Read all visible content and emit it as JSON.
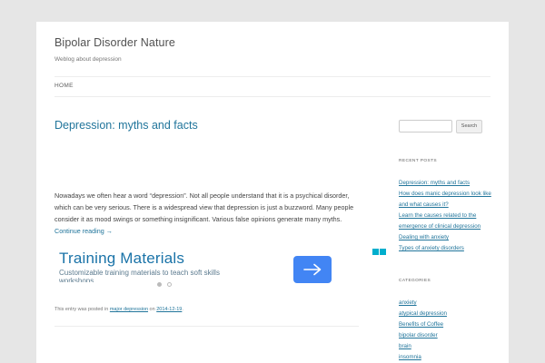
{
  "site": {
    "title": "Bipolar Disorder Nature",
    "description": "Weblog about depression"
  },
  "nav": {
    "home": "HOME"
  },
  "post": {
    "title": "Depression: myths and facts",
    "body": "Nowadays we often hear a word “depression”. Not all people understand that it is a psychical disorder, which can be very serious. There is a widespread view that depression is just a buzzword. Many people consider it as mood swings or something insignificant. Various false opinions generate many myths.",
    "more_link": "Continue reading →",
    "meta": {
      "prefix": "This entry was posted in ",
      "category": "major depression",
      "on": " on ",
      "date": "2014-12-19",
      "suffix": "."
    }
  },
  "ad": {
    "title": "Training Materials",
    "text": "Customizable training materials to teach soft skills workshops",
    "button_icon": "arrow-right-icon",
    "accent": "#4285f4"
  },
  "sidebar": {
    "search": {
      "value": "",
      "placeholder": "",
      "button": "Search"
    },
    "recent_posts": {
      "title": "RECENT POSTS",
      "items": [
        "Depression: myths and facts",
        "How does manic depression look like and what causes it?",
        "Learn the causes related to the emergence of clinical depression",
        "Dealing with anxiety",
        "Types of anxiety disorders"
      ]
    },
    "categories": {
      "title": "CATEGORIES",
      "items": [
        "anxiety",
        "atypical depression",
        "Benefits of Coffee",
        "bipolar disorder",
        "brain",
        "insomnia"
      ]
    }
  }
}
